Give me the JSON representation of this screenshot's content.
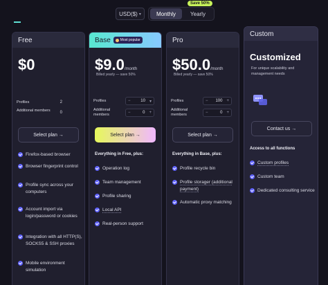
{
  "header": {
    "currency": "USD($)",
    "toggle": {
      "monthly": "Monthly",
      "yearly": "Yearly"
    },
    "save_badge": "Save 50%"
  },
  "plans": {
    "free": {
      "name": "Free",
      "price": "$0",
      "profiles_label": "Profiles",
      "profiles_value": "2",
      "members_label": "Additional members",
      "members_value": "0",
      "button": "Select plan →",
      "features": [
        "Firefox-based browser",
        "Browser fingerprint control",
        "Profile sync across your computers",
        "Account import via login/password or cookies",
        "Integration with all HTTP(S), SOCKS5 & SSH proxies",
        "Mobile environment simulation"
      ]
    },
    "base": {
      "name": "Base",
      "badge": "Most popular",
      "price": "$9.0",
      "per": "/month",
      "billed": "Billed yearly — save 50%",
      "profiles_label": "Profiles",
      "profiles_value": "10",
      "members_label": "Additional members",
      "members_value": "0",
      "button": "Select plan →",
      "section": "Everything in Free, plus:",
      "features": [
        "Operation log",
        "Team management",
        "Profile sharing",
        "Local API",
        "Real-person support"
      ]
    },
    "pro": {
      "name": "Pro",
      "price": "$50.0",
      "per": "/month",
      "billed": "Billed yearly — save 50%",
      "profiles_label": "Profiles",
      "profiles_value": "100",
      "members_label": "Additional members",
      "members_value": "0",
      "button": "Select plan →",
      "section": "Everything in Base, plus:",
      "features": [
        "Profile recycle bin",
        "Profile storager (additional payment)",
        "Automatic proxy matching"
      ]
    },
    "custom": {
      "name": "Custom",
      "title": "Customized",
      "subtitle": "For unique scalability and management needs",
      "button": "Contact us →",
      "section": "Access to all functions",
      "features": [
        "Custom profiles",
        "Custom team",
        "Dedicated consulting service"
      ]
    }
  },
  "colors": {
    "background": "#14131d",
    "accent_check": "#5f62ff",
    "save_badge": "#c6f15a",
    "base_header_gradient": [
      "#58e7d0",
      "#87c9ff"
    ],
    "base_button_gradient": [
      "#e6f85b",
      "#f0b7ff"
    ]
  },
  "icons": {
    "check": "check-circle-icon",
    "chat": "chat-bubbles-icon",
    "popular": "sparkle-icon",
    "stepper_up": "chevron-up-icon",
    "stepper_down": "chevron-down-icon"
  }
}
